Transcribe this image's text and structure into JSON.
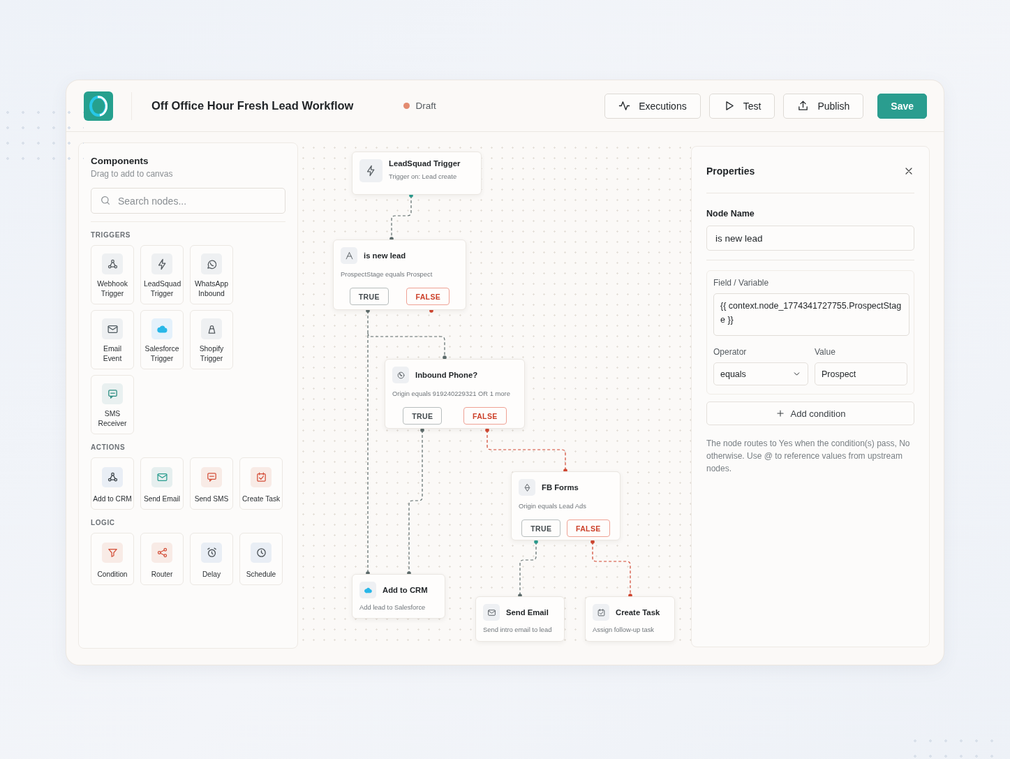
{
  "header": {
    "title": "Off Office Hour Fresh Lead Workflow",
    "status": {
      "label": "Draft",
      "color": "#e38b70"
    },
    "buttons": [
      {
        "label": "Executions",
        "kind": "outline"
      },
      {
        "label": "Test",
        "kind": "outline"
      },
      {
        "label": "Publish",
        "kind": "outline"
      },
      {
        "label": "Save",
        "kind": "primary"
      }
    ]
  },
  "components": {
    "title": "Components",
    "subtitle": "Drag to add to canvas",
    "search": {
      "placeholder": "Search nodes..."
    },
    "sections": [
      {
        "heading": "TRIGGERS",
        "items": [
          "Webhook Trigger",
          "LeadSquad Trigger",
          "WhatsApp Inbound",
          "Email Event",
          "Salesforce Trigger",
          "Shopify Trigger",
          "SMS Receiver"
        ]
      },
      {
        "heading": "ACTIONS",
        "items": [
          "Add to CRM",
          "Send Email",
          "Send SMS",
          "Create Task"
        ]
      },
      {
        "heading": "LOGIC",
        "items": [
          "Condition",
          "Router",
          "Delay",
          "Schedule"
        ]
      }
    ]
  },
  "canvas": {
    "nodes": [
      {
        "kind": "trigger",
        "title": "LeadSquad Trigger",
        "subtitle": "Trigger on: Lead create"
      },
      {
        "kind": "condition",
        "title": "is new lead",
        "subtitle": "ProspectStage equals Prospect",
        "branches": [
          {
            "label": "TRUE",
            "kind": "true"
          },
          {
            "label": "FALSE",
            "kind": "false"
          }
        ]
      },
      {
        "kind": "condition",
        "title": "Inbound Phone?",
        "subtitle": "Origin equals 919240229321 OR 1 more",
        "branches": [
          {
            "label": "TRUE",
            "kind": "true"
          },
          {
            "label": "FALSE",
            "kind": "false"
          }
        ]
      },
      {
        "kind": "condition",
        "title": "FB Forms",
        "subtitle": "Origin equals Lead Ads",
        "branches": [
          {
            "label": "TRUE",
            "kind": "true"
          },
          {
            "label": "FALSE",
            "kind": "false"
          }
        ]
      },
      {
        "kind": "action",
        "title": "Add to CRM",
        "subtitle": "Add lead to Salesforce"
      },
      {
        "kind": "action",
        "title": "Send Email",
        "subtitle": "Send intro email to lead"
      },
      {
        "kind": "action",
        "title": "Create Task",
        "subtitle": "Assign follow-up task"
      }
    ]
  },
  "properties": {
    "title": "Properties",
    "node_name": {
      "label": "Node Name",
      "value": "is new lead"
    },
    "condition": {
      "field_label": "Field / Variable",
      "field_value": "{{ context.node_1774341727755.ProspectStage }}",
      "operator_label": "Operator",
      "operator_value": "equals",
      "value_label": "Value",
      "value": "Prospect"
    },
    "add_button": "Add condition",
    "help": "The node routes to Yes when the condition(s) pass, No otherwise. Use @ to reference values from upstream nodes."
  }
}
